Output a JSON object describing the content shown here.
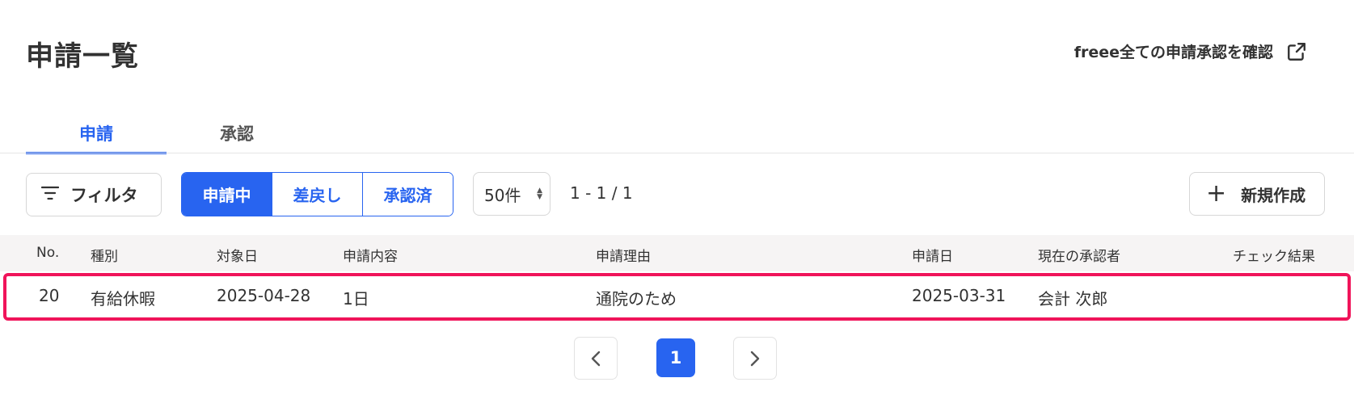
{
  "header": {
    "title": "申請一覧",
    "external_link_label": "freee全ての申請承認を確認"
  },
  "tabs": [
    {
      "label": "申請",
      "active": true
    },
    {
      "label": "承認",
      "active": false
    }
  ],
  "toolbar": {
    "filter_label": "フィルタ",
    "status_segments": [
      {
        "label": "申請中",
        "selected": true
      },
      {
        "label": "差戻し",
        "selected": false
      },
      {
        "label": "承認済",
        "selected": false
      }
    ],
    "page_size": "50件",
    "range_text": "1 - 1 / 1",
    "new_button_label": "新規作成"
  },
  "table": {
    "columns": [
      "No.",
      "種別",
      "対象日",
      "申請内容",
      "申請理由",
      "申請日",
      "現在の承認者",
      "チェック結果"
    ],
    "rows": [
      {
        "no": "20",
        "type": "有給休暇",
        "target_date": "2025-04-28",
        "content": "1日",
        "reason": "通院のため",
        "applied_date": "2025-03-31",
        "approver": "会計 次郎",
        "check_result": ""
      }
    ]
  },
  "pagination": {
    "current_page": "1"
  },
  "colors": {
    "accent": "#2864f0",
    "highlight": "#f0145a",
    "table_header_bg": "#f6f4f4"
  }
}
